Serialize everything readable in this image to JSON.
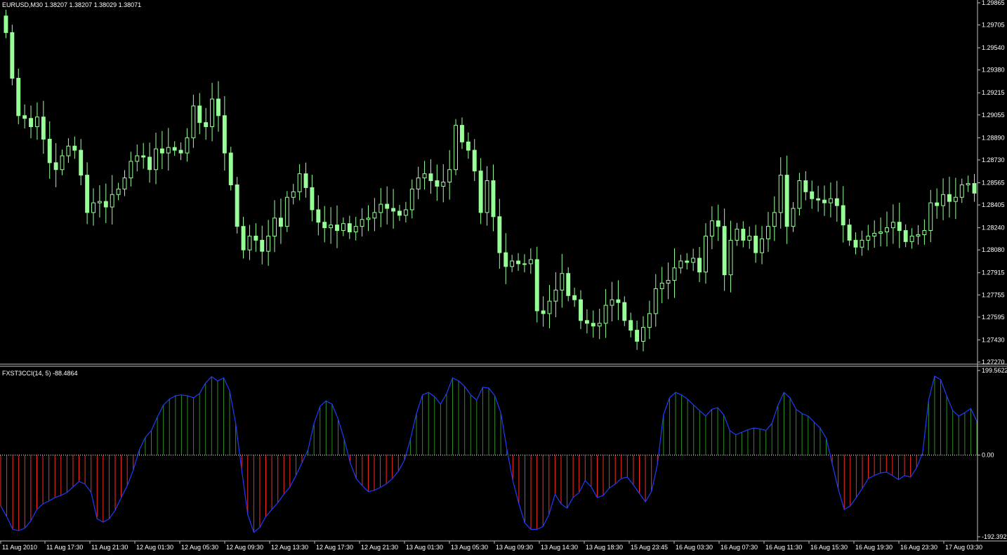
{
  "chart_header": {
    "symbol_line": "EURUSD,M30  1.38207 1.38207 1.38029 1.38071",
    "indicator_line": "FXST3CCI(14, 5) -88.4864"
  },
  "colors": {
    "background": "#000000",
    "axis": "#c0c0c0",
    "candle": "#98ff98",
    "hist_positive": "#2e8b22",
    "hist_negative": "#ff2a1a",
    "cci_line": "#1e3cff",
    "zero_line": "#ffffff"
  },
  "chart_data": [
    {
      "type": "candlestick",
      "title": "EURUSD,M30  1.38207 1.38207 1.38029 1.38071",
      "price_axis_ticks": [
        "1.29865",
        "1.29705",
        "1.29540",
        "1.29380",
        "1.29215",
        "1.29055",
        "1.28890",
        "1.28730",
        "1.28565",
        "1.28405",
        "1.28240",
        "1.28080",
        "1.27915",
        "1.27755",
        "1.27595",
        "1.27430",
        "1.27270"
      ],
      "ylim": [
        1.2727,
        1.29865
      ],
      "time_axis_ticks": [
        "11 Aug 2010",
        "11 Aug 17:30",
        "11 Aug 21:30",
        "12 Aug 01:30",
        "12 Aug 05:30",
        "12 Aug 09:30",
        "12 Aug 13:30",
        "12 Aug 17:30",
        "12 Aug 21:30",
        "13 Aug 01:30",
        "13 Aug 05:30",
        "13 Aug 09:30",
        "13 Aug 14:30",
        "13 Aug 18:30",
        "15 Aug 23:45",
        "16 Aug 03:30",
        "16 Aug 07:30",
        "16 Aug 11:30",
        "16 Aug 15:30",
        "16 Aug 19:30",
        "16 Aug 23:30",
        "17 Aug 03:30"
      ],
      "grid": false,
      "closes": [
        1.2965,
        1.2932,
        1.2905,
        1.2903,
        1.2897,
        1.2904,
        1.2888,
        1.2871,
        1.2866,
        1.2876,
        1.2883,
        1.288,
        1.2862,
        1.2835,
        1.2842,
        1.2843,
        1.2839,
        1.2848,
        1.2852,
        1.286,
        1.2872,
        1.2876,
        1.2875,
        1.2866,
        1.2881,
        1.2878,
        1.2882,
        1.288,
        1.2878,
        1.2889,
        1.2912,
        1.29,
        1.2897,
        1.2917,
        1.2905,
        1.2878,
        1.2855,
        1.2825,
        1.2808,
        1.2818,
        1.2815,
        1.2807,
        1.2818,
        1.2831,
        1.2825,
        1.2846,
        1.285,
        1.2863,
        1.2853,
        1.2837,
        1.2828,
        1.2824,
        1.2826,
        1.2822,
        1.2827,
        1.2821,
        1.2825,
        1.283,
        1.2831,
        1.2835,
        1.2841,
        1.2838,
        1.2836,
        1.2833,
        1.2837,
        1.2852,
        1.286,
        1.2863,
        1.2858,
        1.2854,
        1.2857,
        1.2866,
        1.2898,
        1.2886,
        1.288,
        1.2865,
        1.2835,
        1.2858,
        1.2832,
        1.2806,
        1.2796,
        1.28,
        1.2798,
        1.2798,
        1.2801,
        1.2764,
        1.2762,
        1.2771,
        1.2779,
        1.2791,
        1.2775,
        1.2772,
        1.2757,
        1.2755,
        1.2753,
        1.2755,
        1.2768,
        1.2772,
        1.277,
        1.2757,
        1.275,
        1.2742,
        1.2752,
        1.2762,
        1.278,
        1.2784,
        1.2786,
        1.2795,
        1.28,
        1.2799,
        1.2802,
        1.2792,
        1.2818,
        1.2829,
        1.2825,
        1.279,
        1.2815,
        1.2823,
        1.2815,
        1.2818,
        1.2806,
        1.2816,
        1.2825,
        1.2835,
        1.2862,
        1.2825,
        1.2838,
        1.2858,
        1.285,
        1.2845,
        1.2844,
        1.2842,
        1.2845,
        1.284,
        1.2826,
        1.2815,
        1.281,
        1.2815,
        1.2818,
        1.282,
        1.2821,
        1.2824,
        1.2828,
        1.2822,
        1.2814,
        1.2818,
        1.2819,
        1.2822,
        1.2842,
        1.284,
        1.2848,
        1.2843,
        1.2846,
        1.2855,
        1.2856,
        1.2849
      ]
    },
    {
      "type": "bar+line",
      "title": "FXST3CCI(14, 5) -88.4864",
      "value_axis_ticks": [
        "199.5622",
        "0.00",
        "-192.392"
      ],
      "ylim": [
        -192.392,
        199.5622
      ],
      "values": [
        -120,
        -145,
        -175,
        -178,
        -172,
        -155,
        -128,
        -115,
        -108,
        -100,
        -95,
        -88,
        -75,
        -62,
        -68,
        -88,
        -150,
        -158,
        -150,
        -130,
        -100,
        -72,
        -35,
        12,
        42,
        58,
        90,
        118,
        132,
        140,
        142,
        140,
        135,
        145,
        170,
        185,
        175,
        182,
        152,
        75,
        -35,
        -140,
        -182,
        -170,
        -145,
        -128,
        -112,
        -92,
        -75,
        -48,
        -18,
        12,
        75,
        115,
        128,
        120,
        85,
        38,
        -18,
        -55,
        -72,
        -86,
        -83,
        -76,
        -68,
        -55,
        -38,
        -12,
        38,
        98,
        142,
        148,
        138,
        120,
        145,
        182,
        175,
        162,
        142,
        130,
        160,
        158,
        140,
        100,
        15,
        -60,
        -115,
        -160,
        -175,
        -175,
        -168,
        -140,
        -92,
        -115,
        -125,
        -100,
        -88,
        -60,
        -75,
        -100,
        -95,
        -78,
        -68,
        -55,
        -52,
        -70,
        -90,
        -110,
        -86,
        -22,
        95,
        135,
        148,
        142,
        132,
        118,
        105,
        92,
        108,
        112,
        95,
        58,
        48,
        54,
        60,
        64,
        62,
        58,
        75,
        118,
        148,
        135,
        108,
        98,
        92,
        78,
        64,
        40,
        -20,
        -80,
        -128,
        -120,
        -100,
        -78,
        -55,
        -48,
        -42,
        -40,
        -48,
        -58,
        -48,
        -52,
        -30,
        5,
        130,
        186,
        178,
        140,
        105,
        92,
        100,
        110,
        80
      ]
    }
  ]
}
